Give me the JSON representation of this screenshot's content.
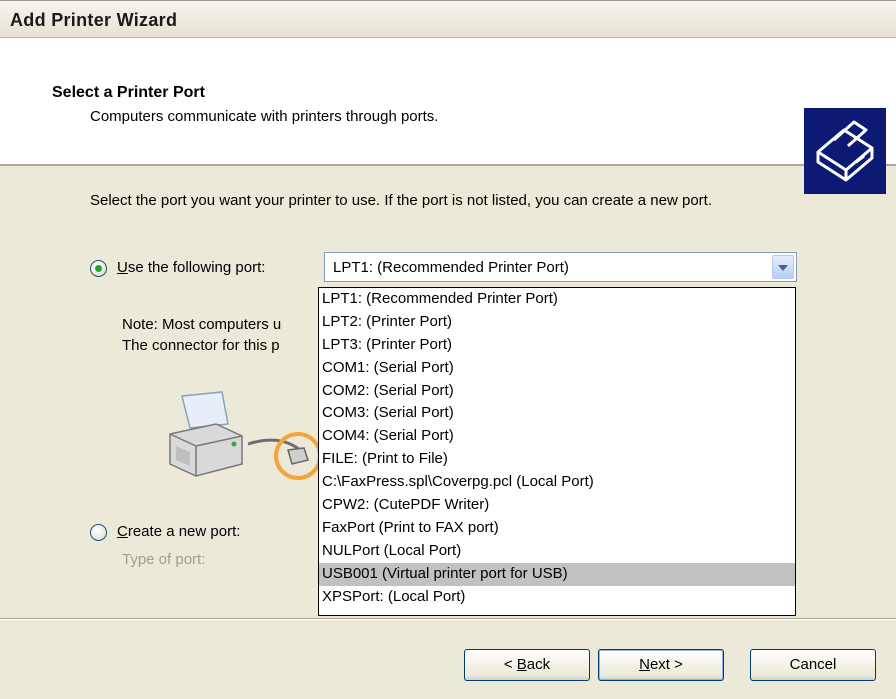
{
  "window": {
    "title": "Add Printer Wizard"
  },
  "header": {
    "title": "Select a Printer Port",
    "subtitle": "Computers communicate with printers through ports."
  },
  "intro_text": "Select the port you want your printer to use.  If the port is not listed, you can create a new port.",
  "use_port": {
    "label_access": "U",
    "label_rest": "se the following port:",
    "selected": "LPT1: (Recommended Printer Port)",
    "checked": true
  },
  "note": {
    "line1": "Note: Most computers u",
    "line2": "The connector for this p"
  },
  "port_options": [
    "LPT1: (Recommended Printer Port)",
    "LPT2: (Printer Port)",
    "LPT3: (Printer Port)",
    "COM1: (Serial Port)",
    "COM2: (Serial Port)",
    "COM3: (Serial Port)",
    "COM4: (Serial Port)",
    "FILE: (Print to File)",
    "C:\\FaxPress.spl\\Coverpg.pcl (Local Port)",
    "CPW2: (CutePDF Writer)",
    "FaxPort (Print to FAX port)",
    "NULPort (Local Port)",
    "USB001 (Virtual printer port for USB)",
    "XPSPort: (Local Port)"
  ],
  "highlighted_option": "USB001 (Virtual printer port for USB)",
  "create_port": {
    "label_access": "C",
    "label_rest": "reate a new port:",
    "type_label": "Type of port:",
    "checked": false
  },
  "buttons": {
    "back_access": "B",
    "back_rest": "ack",
    "back_prefix": "< ",
    "next_access": "N",
    "next_rest": "ext >",
    "cancel": "Cancel"
  },
  "colors": {
    "dialog_bg": "#ece9d8",
    "header_bg": "#ffffff",
    "highlight": "#c1c1c1",
    "accent_orange": "#f5a33b",
    "icon_bg": "#0c1a73"
  },
  "icons": {
    "header": "printer-wizard-icon",
    "illustration": "printer-cable-illustration",
    "combo": "chevron-down-icon"
  }
}
